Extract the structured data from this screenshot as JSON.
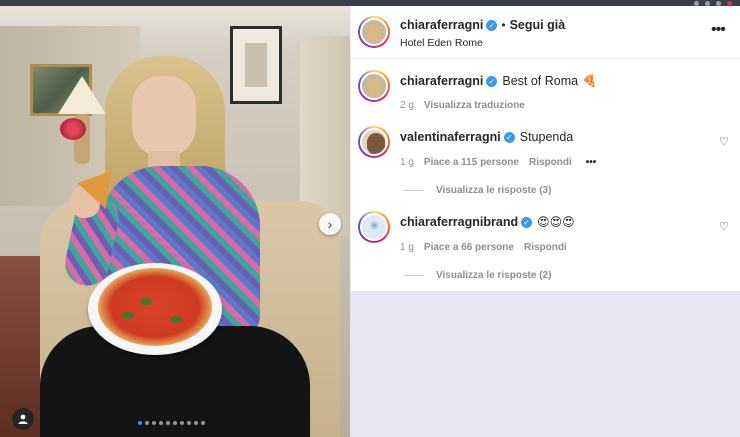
{
  "post": {
    "author": "chiaraferragni",
    "follow_label": "Segui già",
    "separator": "•",
    "location": "Hotel Eden Rome",
    "more_label": "•••",
    "next_glyph": "›",
    "carousel_count": 10,
    "carousel_active": 0
  },
  "caption": {
    "author": "chiaraferragni",
    "text": "Best of Roma",
    "emoji": "🍕",
    "time": "2 g",
    "translate_label": "Visualizza traduzione"
  },
  "comments": [
    {
      "author": "valentinaferragni",
      "text": "Stupenda",
      "emoji": "",
      "time": "1 g",
      "likes": "Piace a 115 persone",
      "reply_label": "Rispondi",
      "options": "•••",
      "view_replies": "Visualizza le risposte (3)"
    },
    {
      "author": "chiaraferragnibrand",
      "text": "",
      "emoji": "😍😍😍",
      "time": "1 g",
      "likes": "Piace a 66 persone",
      "reply_label": "Rispondi",
      "options": "",
      "view_replies": "Visualizza le risposte (2)"
    }
  ],
  "icons": {
    "heart": "♡",
    "verified": "✓",
    "user": "👤"
  },
  "colors": {
    "verified_blue": "#3897f0",
    "meta_gray": "#8e8e8e",
    "text": "#262626"
  }
}
